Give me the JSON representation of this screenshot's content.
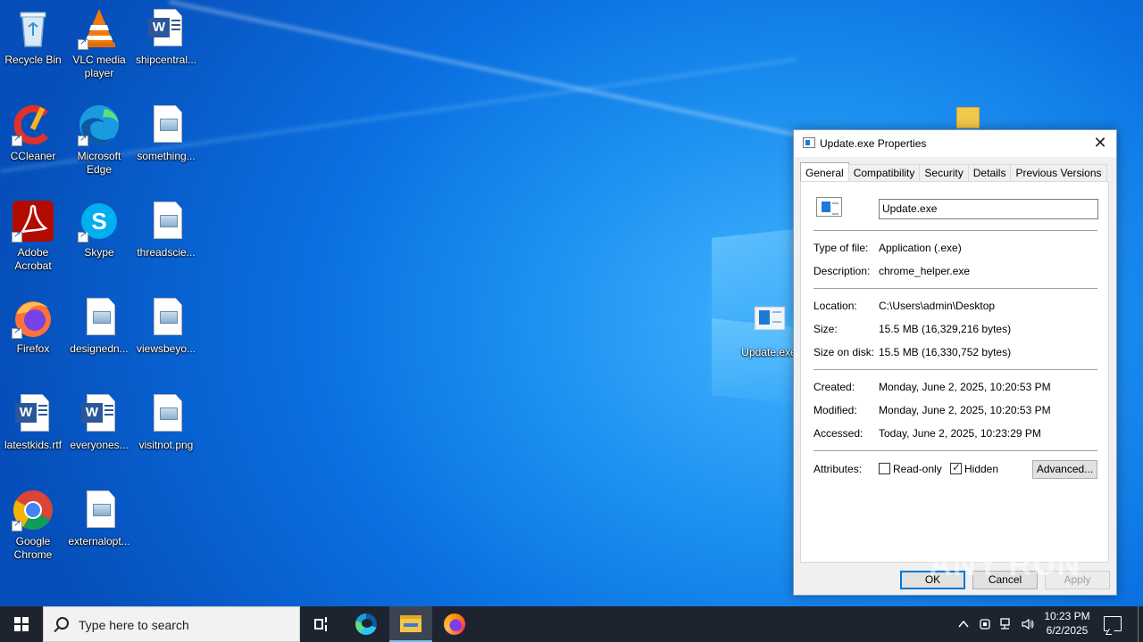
{
  "desktop": {
    "icons": [
      {
        "label": "Recycle Bin"
      },
      {
        "label": "VLC media player"
      },
      {
        "label": "shipcentral..."
      },
      {
        "label": "CCleaner"
      },
      {
        "label": "Microsoft Edge"
      },
      {
        "label": "something..."
      },
      {
        "label": "Adobe Acrobat"
      },
      {
        "label": "Skype"
      },
      {
        "label": "threadscie..."
      },
      {
        "label": "Firefox"
      },
      {
        "label": "designedn..."
      },
      {
        "label": "viewsbeyo..."
      },
      {
        "label": "latestkids.rtf"
      },
      {
        "label": "everyones..."
      },
      {
        "label": "visitnot.png"
      },
      {
        "label": "Google Chrome"
      },
      {
        "label": "externalopt..."
      },
      {
        "label": "Update.exe"
      }
    ]
  },
  "dialog": {
    "title": "Update.exe Properties",
    "close_glyph": "✕",
    "tabs": [
      "General",
      "Compatibility",
      "Security",
      "Details",
      "Previous Versions"
    ],
    "file_name": "Update.exe",
    "type_label": "Type of file:",
    "type_value": "Application (.exe)",
    "description_label": "Description:",
    "description_value": "chrome_helper.exe",
    "location_label": "Location:",
    "location_value": "C:\\Users\\admin\\Desktop",
    "size_label": "Size:",
    "size_value": "15.5 MB (16,329,216 bytes)",
    "size_on_disk_label": "Size on disk:",
    "size_on_disk_value": "15.5 MB (16,330,752 bytes)",
    "created_label": "Created:",
    "created_value": "Monday, June 2, 2025, 10:20:53 PM",
    "modified_label": "Modified:",
    "modified_value": "Monday, June 2, 2025, 10:20:53 PM",
    "accessed_label": "Accessed:",
    "accessed_value": "Today, June 2, 2025, 10:23:29 PM",
    "attributes_label": "Attributes:",
    "readonly_label": "Read-only",
    "readonly_checked": false,
    "hidden_label": "Hidden",
    "hidden_checked": true,
    "advanced_label": "Advanced...",
    "ok_label": "OK",
    "cancel_label": "Cancel",
    "apply_label": "Apply"
  },
  "watermark": "ANY RUN",
  "taskbar": {
    "search_placeholder": "Type here to search",
    "time": "10:23 PM",
    "date": "6/2/2025"
  }
}
